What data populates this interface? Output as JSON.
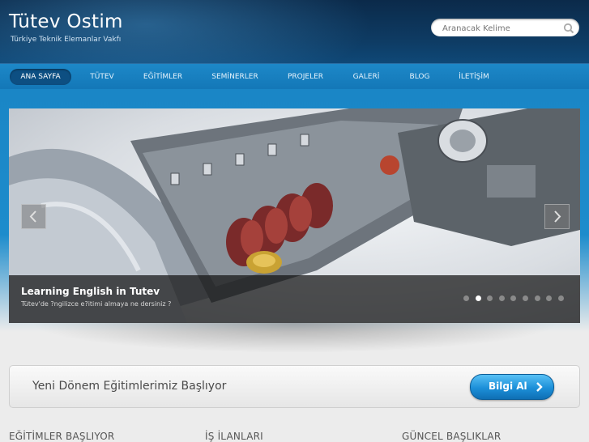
{
  "header": {
    "logo_title": "Tütev Ostim",
    "logo_subtitle": "Türkiye Teknik Elemanlar Vakfı"
  },
  "search": {
    "placeholder": "Aranacak Kelime",
    "icon": "search-icon"
  },
  "nav": {
    "items": [
      {
        "label": "ANA SAYFA",
        "active": true
      },
      {
        "label": "TÜTEV"
      },
      {
        "label": "EĞİTİMLER"
      },
      {
        "label": "SEMİNERLER"
      },
      {
        "label": "PROJELER"
      },
      {
        "label": "GALERİ"
      },
      {
        "label": "BLOG"
      },
      {
        "label": "İLETİŞİM"
      }
    ]
  },
  "slider": {
    "title": "Learning English in Tutev",
    "text": "Tütev'de ?ngilizce e?itimi almaya ne dersiniz ?",
    "slide_count": 9,
    "active_index": 1,
    "prev_icon": "chevron-left-icon",
    "next_icon": "chevron-right-icon"
  },
  "promo": {
    "text": "Yeni Dönem Eğitimlerimiz Başlıyor",
    "button_label": "Bilgi Al",
    "button_icon": "chevron-right-icon"
  },
  "columns": {
    "col1": "EĞİTİMLER BAŞLIYOR",
    "col2": "İŞ İLANLARI",
    "col3": "GÜNCEL BAŞLIKLAR"
  },
  "colors": {
    "header_dark": "#0b2a4a",
    "nav_blue": "#1377b7",
    "accent_button": "#1c8fd8"
  }
}
